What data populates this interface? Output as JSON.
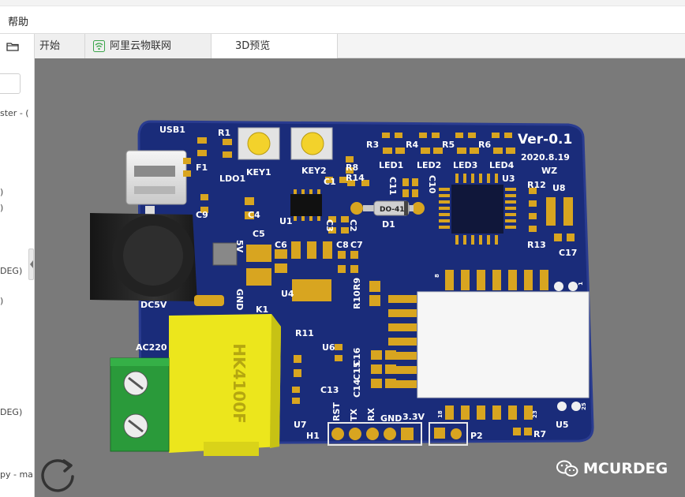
{
  "menu": {
    "help": "帮助"
  },
  "tabs": [
    {
      "label": "开始"
    },
    {
      "label": "阿里云物联网",
      "icon": "wifi-icon"
    },
    {
      "label": "3D预览"
    }
  ],
  "sidebar": {
    "tree_items": [
      "ster - (",
      ")",
      ")",
      "DEG)",
      ")",
      "DEG)",
      "py - ma"
    ]
  },
  "pcb": {
    "silkscreen": {
      "usb": "USB1",
      "r1": "R1",
      "f1": "F1",
      "ldo1": "LDO1",
      "key1": "KEY1",
      "key2": "KEY2",
      "c1": "C1",
      "r8": "R8",
      "r14": "R14",
      "r3": "R3",
      "r4": "R4",
      "r5": "R5",
      "r6": "R6",
      "led1": "LED1",
      "led2": "LED2",
      "led3": "LED3",
      "led4": "LED4",
      "version": "Ver-0.1",
      "date": "2020.8.19",
      "author": "WZ",
      "u3": "U3",
      "c11": "C11",
      "c10": "C10",
      "c9": "C9",
      "c4": "C4",
      "u1": "U1",
      "c3": "C3",
      "c2": "C2",
      "d1": "D1",
      "do41": "DO-41",
      "r12": "R12",
      "u8": "U8",
      "r13": "R13",
      "c17": "C17",
      "v5": "5V",
      "c5": "C5",
      "c6": "C6",
      "c8": "C8",
      "c7": "C7",
      "r10": "R10",
      "r9": "R9",
      "dc5v": "DC5V",
      "gnd_left": "GND",
      "u4": "U4",
      "k1": "K1",
      "ac220": "AC220",
      "r11": "R11",
      "u6": "U6",
      "c16": "C16",
      "c15": "C15",
      "c14": "C14",
      "c13": "C13",
      "u7": "U7",
      "relay": "HK4100F",
      "h1": "H1",
      "rst": "RST",
      "tx": "TX",
      "rx": "RX",
      "gnd_bottom": "GND",
      "v33": "3.3V",
      "p2": "P2",
      "r7": "R7",
      "u5": "U5",
      "pin8": "8",
      "pin1": "1",
      "pin18": "18",
      "pin23": "23",
      "pin25": "25"
    }
  },
  "watermark": {
    "text": "MCURDEG",
    "icon": "wechat-icon"
  },
  "colors": {
    "board": "#1a2c7a",
    "board_edge": "#2a3c90",
    "pad": "#d8a520",
    "silkscreen": "#ffffff",
    "relay": "#e8e21a",
    "terminal": "#2a9a3a",
    "viewport_bg": "#7a7a7a"
  }
}
